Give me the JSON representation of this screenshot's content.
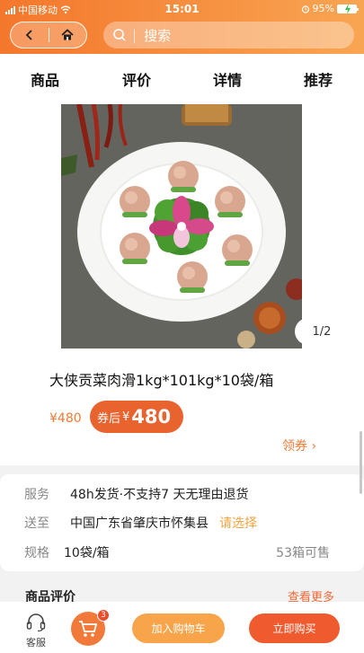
{
  "status": {
    "carrier": "中国移动",
    "time": "15:01",
    "battery": "95%"
  },
  "search": {
    "placeholder": "搜索"
  },
  "tabs": [
    "商品",
    "评价",
    "详情",
    "推荐"
  ],
  "gallery": {
    "counter": "1/2"
  },
  "product": {
    "title": "大侠贡菜肉滑1kg*101kg*10袋/箱",
    "orig_price": "¥480",
    "coupon_label": "券后",
    "coupon_currency": "¥",
    "coupon_amount": "480",
    "coupon_link": "领券 ›"
  },
  "details": {
    "service_key": "服务",
    "service_val": "48h发货·不支持7 天无理由退货",
    "ship_key": "送至",
    "ship_val": "中国广东省肇庆市怀集县",
    "ship_select": "请选择",
    "spec_key": "规格",
    "spec_val": "10袋/箱",
    "stock": "53箱可售"
  },
  "reviews": {
    "heading": "商品评价",
    "more": "查看更多"
  },
  "bottom": {
    "cs_label": "客服",
    "cart_badge": "3",
    "add_cart": "加入购物车",
    "buy_now": "立即购买"
  },
  "colors": {
    "brand": "#f4772c",
    "accent": "#ef5a2e",
    "secondary": "#f7a44a"
  }
}
